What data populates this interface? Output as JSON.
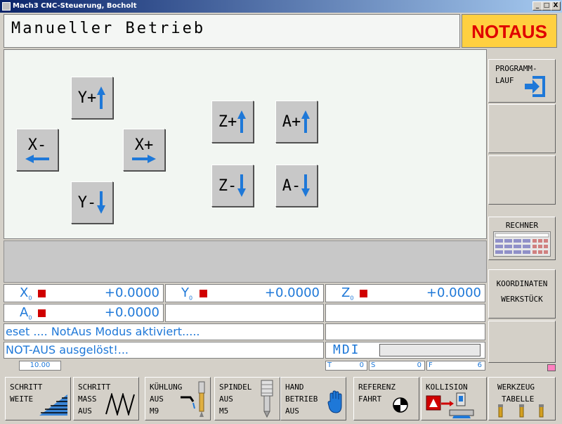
{
  "window": {
    "title": "Mach3 CNC-Steuerung, Bocholt",
    "min": "_",
    "max": "□",
    "close": "X"
  },
  "header": {
    "title": "Manueller Betrieb",
    "notaus": "NOTAUS"
  },
  "jog": {
    "y_plus": "Y+",
    "y_minus": "Y-",
    "x_minus": "X-",
    "x_plus": "X+",
    "z_plus": "Z+",
    "z_minus": "Z-",
    "a_plus": "A+",
    "a_minus": "A-"
  },
  "right": {
    "programmlauf_1": "PROGRAMM-",
    "programmlauf_2": "LAUF",
    "rechner": "RECHNER",
    "koord_1": "KOORDINATEN",
    "koord_2": "WERKSTÜCK"
  },
  "dro": {
    "x": {
      "axis": "X",
      "sub": "0",
      "value": "+0.0000"
    },
    "y": {
      "axis": "Y",
      "sub": "0",
      "value": "+0.0000"
    },
    "z": {
      "axis": "Z",
      "sub": "0",
      "value": "+0.0000"
    },
    "a": {
      "axis": "A",
      "sub": "0",
      "value": "+0.0000"
    }
  },
  "messages": {
    "status": "eset .... NotAus Modus aktiviert.....",
    "error": "NOT-AUS ausgelöst!...",
    "mode": "MDI"
  },
  "bottom_status": {
    "feed_value": "10.00",
    "t_label": "T",
    "t_value": "0",
    "s_label": "S",
    "s_value": "0",
    "f_label": "F",
    "f_value": "6"
  },
  "softkeys": [
    {
      "l1": "SCHRITT",
      "l2": "WEITE",
      "l3": ""
    },
    {
      "l1": "SCHRITT",
      "l2": "MASS",
      "l3": "AUS"
    },
    {
      "l1": "KÜHLUNG",
      "l2": "AUS",
      "l3": "M9"
    },
    {
      "l1": "SPINDEL",
      "l2": "AUS",
      "l3": "M5"
    },
    {
      "l1": "HAND",
      "l2": "BETRIEB",
      "l3": "AUS"
    },
    {
      "l1": "REFERENZ",
      "l2": "FAHRT",
      "l3": ""
    },
    {
      "l1": "KOLLISION",
      "l2": "",
      "l3": ""
    },
    {
      "l1": "WERKZEUG",
      "l2": "TABELLE",
      "l3": ""
    }
  ],
  "colors": {
    "accent": "#1e78d8",
    "notaus_bg": "#ffd040",
    "notaus_text": "#e00000",
    "alarm": "#d00000"
  },
  "icons": [
    "arrow-up-icon",
    "arrow-down-icon",
    "arrow-left-icon",
    "arrow-right-icon",
    "calculator-icon",
    "hand-icon",
    "reference-target-icon",
    "collision-icon",
    "tool-icon",
    "spindle-icon",
    "coolant-icon",
    "zigzag-icon",
    "step-ramp-icon",
    "program-run-icon"
  ]
}
